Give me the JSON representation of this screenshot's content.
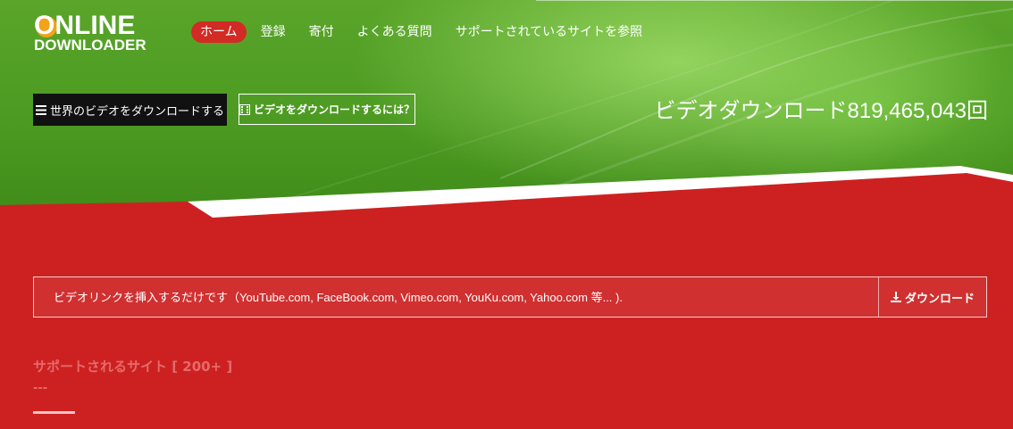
{
  "logo": {
    "top": "ONLINE",
    "bottom": "DOWNLOADER"
  },
  "nav": [
    {
      "label": "ホーム",
      "active": true
    },
    {
      "label": "登録"
    },
    {
      "label": "寄付"
    },
    {
      "label": "よくある質問"
    },
    {
      "label": "サポートされているサイトを参照"
    }
  ],
  "hero": {
    "btn_primary": "世界のビデオをダウンロードする",
    "btn_secondary": "ビデオをダウンロードするには？",
    "counter_prefix": "ビデオダウンロード",
    "counter_value": "819,465,043",
    "counter_suffix": "回"
  },
  "search": {
    "placeholder": "ビデオリンクを挿入するだけです（YouTube.com, FaceBook.com, Vimeo.com, YouKu.com, Yahoo.com 等... ).",
    "button_label": "ダウンロード"
  },
  "supported": {
    "title": "サポートされるサイト [ 200+ ]",
    "dots": "---"
  },
  "colors": {
    "accent_red": "#cd2121",
    "hero_green": "#4c9a22",
    "active_nav": "#d22a24"
  },
  "icons": [
    "list-icon",
    "film-icon",
    "download-icon"
  ]
}
